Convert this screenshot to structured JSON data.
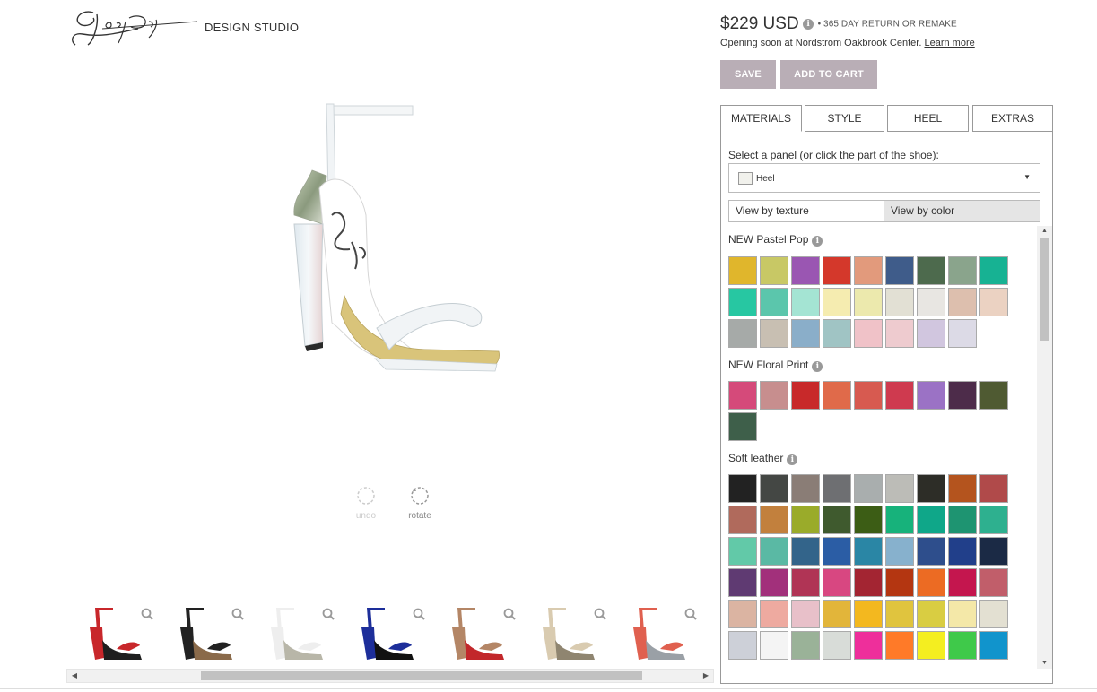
{
  "header": {
    "logo_text": "Shoes of Prey",
    "studio_label": "DESIGN STUDIO"
  },
  "tools": {
    "undo_label": "undo",
    "rotate_label": "rotate"
  },
  "purchase": {
    "price": "$229 USD",
    "return_text": "• 365 DAY RETURN OR REMAKE",
    "opening_text": "Opening soon at Nordstrom Oakbrook Center.",
    "learn_more": "Learn more",
    "save_label": "SAVE",
    "cart_label": "ADD TO CART"
  },
  "tabs": [
    "MATERIALS",
    "STYLE",
    "HEEL",
    "EXTRAS"
  ],
  "materials": {
    "select_label": "Select a panel (or click the part of the shoe):",
    "selected_panel": "Heel",
    "view_texture": "View by texture",
    "view_color": "View by color"
  },
  "sections": [
    {
      "title": "NEW Pastel Pop",
      "swatches": [
        "#e0b62c",
        "#c8c865",
        "#9a56b2",
        "#d4382b",
        "#e29a7c",
        "#3f5c8a",
        "#4d6a4d",
        "#8aa48c",
        "#17b293",
        "#27c7a2",
        "#5bc6ac",
        "#a4e4d3",
        "#f5ecb0",
        "#ece9ad",
        "#e2e0d4",
        "#e8e6e2",
        "#ddbfae",
        "#ebd2c2",
        "#a6aaa8",
        "#c8bfb2",
        "#8aaec9",
        "#a0c4c4",
        "#f0c2c8",
        "#eecbcf",
        "#d1c6df",
        "#dcdae6"
      ]
    },
    {
      "title": "NEW Floral Print",
      "swatches": [
        "#d54a7a",
        "#c78e8e",
        "#c8292a",
        "#e06a4a",
        "#d75a50",
        "#cf3a4f",
        "#9b72c5",
        "#4d2c4a",
        "#4f5a32",
        "#3e5f4a"
      ]
    },
    {
      "title": "Soft leather",
      "swatches": [
        "#222222",
        "#444744",
        "#8a7d76",
        "#6e6f72",
        "#a9aeae",
        "#bcbcb7",
        "#2d2d27",
        "#b4541e",
        "#b04a4a",
        "#b06a5c",
        "#c2803d",
        "#9aab2a",
        "#3f5a2e",
        "#3c5d15",
        "#17b27b",
        "#0fa789",
        "#1e9471",
        "#2eb08f",
        "#62c9a8",
        "#5ab9a4",
        "#33648a",
        "#2b5da5",
        "#2a86a5",
        "#87b1cd",
        "#2e4e8c",
        "#213f8a",
        "#1b2a45",
        "#5f3a72",
        "#a2307b",
        "#b03455",
        "#d84781",
        "#a32532",
        "#b43611",
        "#ec6b23",
        "#c4164e",
        "#c15e6a",
        "#dbb4a2",
        "#eeaaa0",
        "#e8c0c9",
        "#e2b53a",
        "#f3b81f",
        "#e0c43e",
        "#d9cd42",
        "#f4e8a8",
        "#e3e0d2",
        "#cdd0d8",
        "#f4f4f4",
        "#9ab298",
        "#d8dcd8",
        "#ee2f9b",
        "#ff7a28",
        "#f4ee20",
        "#3fc94a",
        "#1194cc"
      ]
    }
  ],
  "thumbnails": [
    {
      "name": "red",
      "color": "#c8272b",
      "accent": "#1f1f1f"
    },
    {
      "name": "leopard",
      "color": "#222222",
      "accent": "#8a6a4a"
    },
    {
      "name": "white",
      "color": "#eeeeee",
      "accent": "#b8b6a8"
    },
    {
      "name": "blue",
      "color": "#1d2e9a",
      "accent": "#111111"
    },
    {
      "name": "tan",
      "color": "#b48666",
      "accent": "#c2272b"
    },
    {
      "name": "snake",
      "color": "#d9cbb0",
      "accent": "#8f8570"
    },
    {
      "name": "coral",
      "color": "#e0604f",
      "accent": "#9aa0a6"
    }
  ],
  "colors": {
    "button_bg": "#b9aeb6",
    "tab_border": "#999999",
    "heel_white": "#eaf0f4",
    "sole_gold": "#d9c47a",
    "snake_print": "#8b9a7e"
  }
}
